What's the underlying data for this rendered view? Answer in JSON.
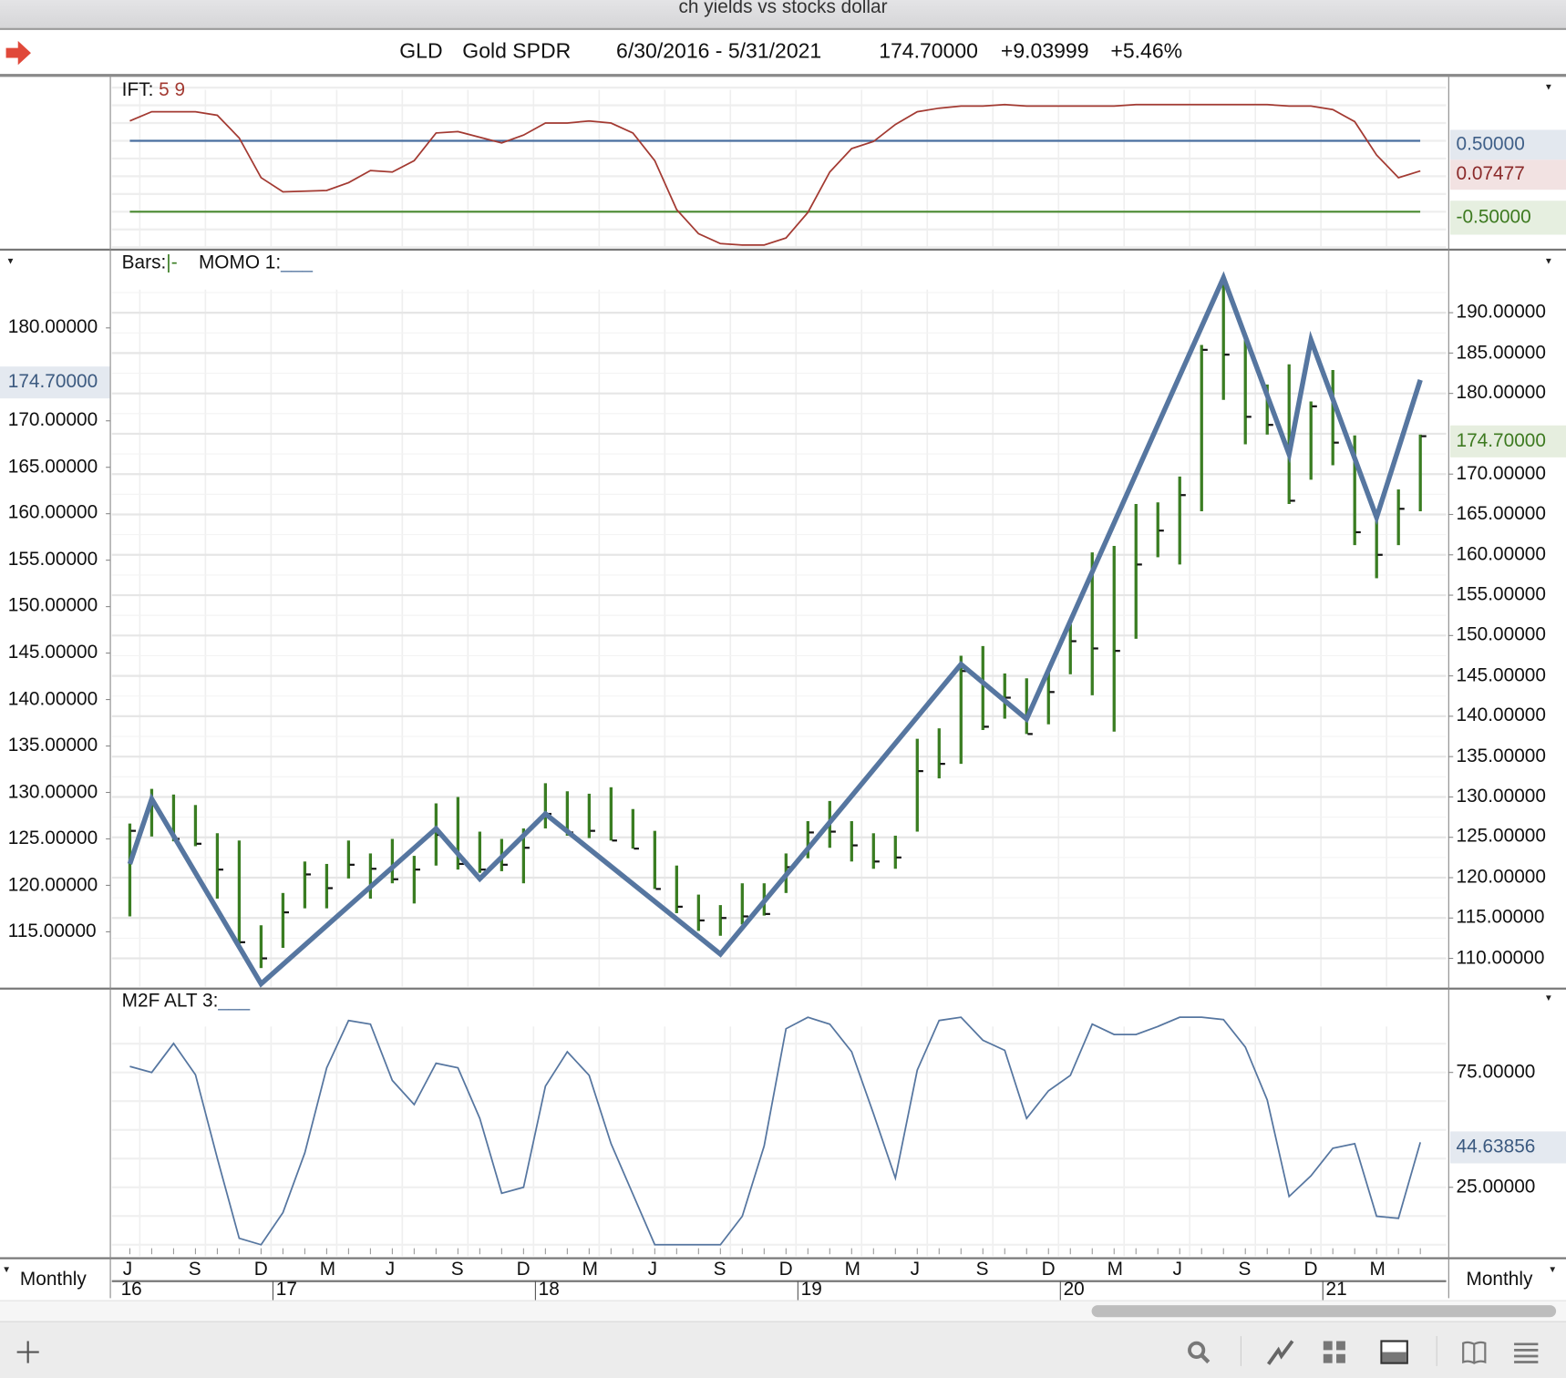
{
  "window_title": "ch yields vs stocks dollar",
  "header": {
    "symbol": "GLD",
    "name": "Gold SPDR",
    "date_range": "6/30/2016 - 5/31/2021",
    "last": "174.70000",
    "change": "+9.03999",
    "change_pct": "+5.46%"
  },
  "panels": {
    "ift": {
      "label": "IFT:",
      "params": "5 9"
    },
    "main": {
      "bars_label": "Bars:",
      "bars_glyph": "|-",
      "momo_label": "MOMO 1:",
      "momo_line": "___"
    },
    "m2f": {
      "label": "M2F ALT 3:",
      "line": "___"
    }
  },
  "periodicity_left": "Monthly",
  "periodicity_right": "Monthly",
  "colors": {
    "bars": "#3a7d22",
    "momo": "#5676a0",
    "ift": "#a33a32",
    "ift_upper": "#4a6fa0",
    "ift_lower": "#4a8a30",
    "m2f": "#5676a0"
  },
  "toolbar": {
    "icons": [
      "plus-icon",
      "search-icon",
      "line-chart-icon",
      "grid-icon",
      "panel-icon",
      "book-icon",
      "menu-icon"
    ]
  },
  "chart_data": [
    {
      "id": "ift",
      "type": "line",
      "title": "IFT: 5 9",
      "ylim": [
        -1.035,
        1.387
      ],
      "levels": [
        0.5,
        -0.5
      ],
      "level_labels": [
        "0.50000",
        "-0.50000"
      ],
      "last_label": "0.07477",
      "values": [
        0.78,
        0.91,
        0.91,
        0.91,
        0.86,
        0.54,
        -0.02,
        -0.22,
        -0.21,
        -0.2,
        -0.09,
        0.08,
        0.06,
        0.22,
        0.61,
        0.63,
        0.55,
        0.47,
        0.58,
        0.75,
        0.75,
        0.78,
        0.75,
        0.61,
        0.22,
        -0.47,
        -0.81,
        -0.95,
        -0.97,
        -0.97,
        -0.87,
        -0.51,
        0.06,
        0.39,
        0.49,
        0.73,
        0.91,
        0.96,
        0.99,
        0.99,
        1.01,
        0.99,
        0.99,
        0.99,
        0.99,
        0.99,
        1.01,
        1.01,
        1.01,
        1.01,
        1.01,
        1.01,
        1.01,
        0.99,
        0.99,
        0.94,
        0.77,
        0.3,
        -0.02,
        0.075
      ]
    },
    {
      "id": "price",
      "type": "bar",
      "title": "GLD Gold SPDR monthly OHLC bars with MOMO 1 zigzag",
      "x_month_labels": [
        "J",
        "S",
        "D",
        "M",
        "J",
        "S",
        "D",
        "M",
        "J",
        "S",
        "D",
        "M",
        "J",
        "S",
        "D",
        "M",
        "J",
        "S",
        "D",
        "M"
      ],
      "x_year_labels": [
        {
          "label": "16",
          "index": 0
        },
        {
          "label": "17",
          "index": 7
        },
        {
          "label": "18",
          "index": 19
        },
        {
          "label": "19",
          "index": 31
        },
        {
          "label": "20",
          "index": 43
        },
        {
          "label": "21",
          "index": 55
        }
      ],
      "right_axis": {
        "ylim": [
          106.5,
          194.1
        ],
        "ticks": [
          "190.00000",
          "185.00000",
          "180.00000",
          "170.00000",
          "165.00000",
          "160.00000",
          "155.00000",
          "150.00000",
          "145.00000",
          "140.00000",
          "135.00000",
          "130.00000",
          "125.00000",
          "120.00000",
          "115.00000",
          "110.00000"
        ],
        "last": "174.70000"
      },
      "left_axis": {
        "ylim": [
          109.1,
          185.2
        ],
        "ticks": [
          "180.00000",
          "170.00000",
          "165.00000",
          "160.00000",
          "155.00000",
          "150.00000",
          "145.00000",
          "140.00000",
          "135.00000",
          "130.00000",
          "125.00000",
          "120.00000",
          "115.00000"
        ],
        "last": "174.70000"
      },
      "high": [
        126.7,
        131.0,
        130.3,
        129.0,
        125.5,
        124.6,
        114.1,
        118.1,
        122.0,
        121.7,
        124.6,
        123.0,
        124.8,
        122.7,
        129.2,
        130.0,
        125.7,
        124.8,
        126.1,
        131.7,
        130.7,
        130.4,
        131.2,
        128.5,
        125.8,
        121.5,
        117.9,
        116.6,
        119.3,
        119.3,
        123.0,
        127.0,
        129.5,
        127.0,
        125.5,
        125.2,
        137.2,
        138.5,
        147.5,
        148.7,
        145.3,
        144.7,
        145.5,
        151.4,
        160.3,
        161.1,
        166.3,
        166.5,
        169.7,
        186.0,
        194.3,
        186.7,
        181.1,
        183.6,
        179.0,
        182.9,
        174.8,
        164.2,
        168.1,
        174.9
      ],
      "low": [
        115.2,
        125.1,
        124.5,
        123.9,
        117.4,
        111.8,
        108.8,
        111.3,
        116.2,
        116.2,
        119.9,
        117.4,
        119.3,
        116.8,
        121.5,
        121.0,
        120.6,
        120.8,
        119.3,
        126.1,
        125.2,
        124.9,
        124.6,
        123.6,
        118.6,
        115.6,
        113.4,
        112.8,
        114.2,
        115.3,
        118.1,
        122.4,
        123.7,
        122.0,
        121.1,
        121.1,
        125.7,
        132.3,
        134.1,
        138.3,
        139.7,
        137.8,
        139.0,
        145.2,
        142.6,
        138.1,
        149.6,
        159.7,
        158.8,
        165.4,
        179.2,
        173.7,
        174.9,
        166.3,
        169.3,
        171.1,
        161.2,
        157.1,
        161.2,
        165.4
      ],
      "close": [
        125.8,
        129.0,
        124.8,
        124.2,
        121.0,
        112.0,
        110.0,
        115.7,
        120.4,
        118.7,
        121.6,
        121.1,
        119.8,
        121.0,
        125.3,
        121.7,
        121.0,
        121.6,
        123.7,
        127.9,
        125.6,
        125.8,
        124.6,
        123.6,
        118.6,
        116.4,
        114.7,
        115.0,
        115.2,
        115.5,
        121.3,
        125.6,
        125.7,
        124.0,
        122.0,
        122.5,
        133.2,
        134.1,
        145.6,
        138.7,
        142.3,
        137.8,
        143.0,
        149.3,
        148.4,
        148.1,
        158.8,
        163.0,
        167.4,
        185.4,
        184.8,
        177.1,
        176.1,
        166.7,
        178.4,
        173.9,
        162.8,
        160.0,
        165.7,
        174.7
      ],
      "momo_points": [
        {
          "index": 0,
          "value": 122.3
        },
        {
          "index": 1,
          "value": 129.3
        },
        {
          "index": 6,
          "value": 109.4
        },
        {
          "index": 14,
          "value": 126.1
        },
        {
          "index": 16,
          "value": 120.7
        },
        {
          "index": 19,
          "value": 127.7
        },
        {
          "index": 27,
          "value": 112.6
        },
        {
          "index": 38,
          "value": 143.8
        },
        {
          "index": 41,
          "value": 137.9
        },
        {
          "index": 50,
          "value": 185.4
        },
        {
          "index": 53,
          "value": 166.4
        },
        {
          "index": 54,
          "value": 178.7
        },
        {
          "index": 57,
          "value": 159.6
        },
        {
          "index": 59,
          "value": 174.4
        }
      ]
    },
    {
      "id": "m2f",
      "type": "line",
      "title": "M2F ALT 3",
      "ylim": [
        -5,
        99.3
      ],
      "ticks": [
        "75.00000",
        "25.00000"
      ],
      "last_label": "44.63856",
      "values": [
        77.6,
        75,
        87.6,
        74,
        37.6,
        2.8,
        0,
        14,
        40,
        77,
        97.6,
        96,
        71.5,
        61,
        79,
        77,
        55,
        22.4,
        25,
        69,
        84,
        73.7,
        44,
        22,
        0,
        0,
        0,
        0,
        12.4,
        43,
        94,
        99,
        96,
        84,
        57,
        29,
        76,
        97.6,
        99,
        89,
        84.6,
        55,
        67,
        73.7,
        96,
        91.5,
        91.5,
        95,
        99,
        99,
        98,
        86,
        63,
        21,
        30,
        42,
        44,
        12.4,
        11.5,
        44.6
      ]
    }
  ]
}
